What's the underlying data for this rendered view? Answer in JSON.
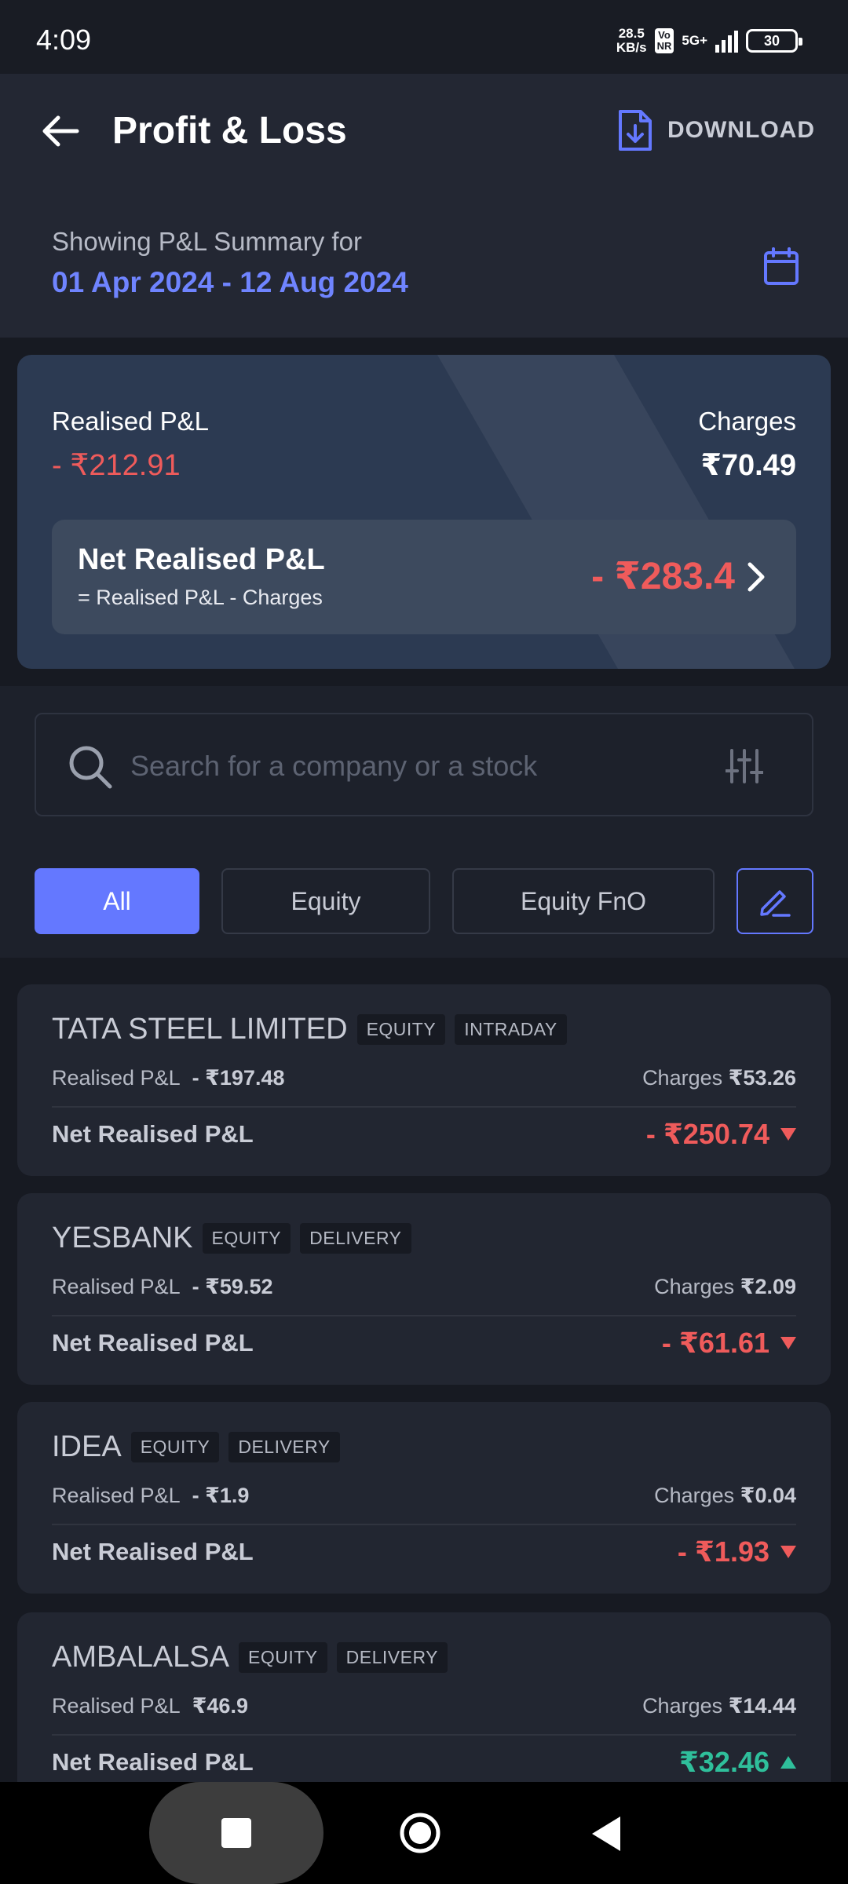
{
  "status_bar": {
    "time": "4:09",
    "net_speed_value": "28.5",
    "net_speed_unit": "KB/s",
    "volte_top": "Vo",
    "volte_bottom": "NR",
    "network": "5G+",
    "battery": "30"
  },
  "header": {
    "title": "Profit & Loss",
    "download_label": "DOWNLOAD"
  },
  "range": {
    "caption": "Showing P&L Summary for",
    "value": "01 Apr 2024 - 12 Aug 2024"
  },
  "summary": {
    "realised_label": "Realised P&L",
    "realised_value": "- ₹212.91",
    "charges_label": "Charges",
    "charges_value": "₹70.49",
    "net_title": "Net Realised P&L",
    "net_formula": "= Realised P&L - Charges",
    "net_value": "- ₹283.4"
  },
  "search": {
    "placeholder": "Search for a company or a stock"
  },
  "filters": {
    "all": "All",
    "equity": "Equity",
    "equity_fno": "Equity FnO"
  },
  "stocks": [
    {
      "name": "TATA STEEL LIMITED",
      "tags": [
        "EQUITY",
        "INTRADAY"
      ],
      "realised_label": "Realised P&L",
      "realised_value": "- ₹197.48",
      "charges_label": "Charges",
      "charges_value": "₹53.26",
      "net_label": "Net Realised P&L",
      "net_value": "- ₹250.74",
      "direction": "down"
    },
    {
      "name": "YESBANK",
      "tags": [
        "EQUITY",
        "DELIVERY"
      ],
      "realised_label": "Realised P&L",
      "realised_value": "- ₹59.52",
      "charges_label": "Charges",
      "charges_value": "₹2.09",
      "net_label": "Net Realised P&L",
      "net_value": "- ₹61.61",
      "direction": "down"
    },
    {
      "name": "IDEA",
      "tags": [
        "EQUITY",
        "DELIVERY"
      ],
      "realised_label": "Realised P&L",
      "realised_value": "- ₹1.9",
      "charges_label": "Charges",
      "charges_value": "₹0.04",
      "net_label": "Net Realised P&L",
      "net_value": "- ₹1.93",
      "direction": "down"
    },
    {
      "name": "AMBALALSA",
      "tags": [
        "EQUITY",
        "DELIVERY"
      ],
      "realised_label": "Realised P&L",
      "realised_value": "₹46.9",
      "charges_label": "Charges",
      "charges_value": "₹14.44",
      "net_label": "Net Realised P&L",
      "net_value": "₹32.46",
      "direction": "up"
    }
  ],
  "colors": {
    "accent": "#6478ff",
    "loss": "#ef5b5b",
    "gain": "#2fbf9b"
  }
}
